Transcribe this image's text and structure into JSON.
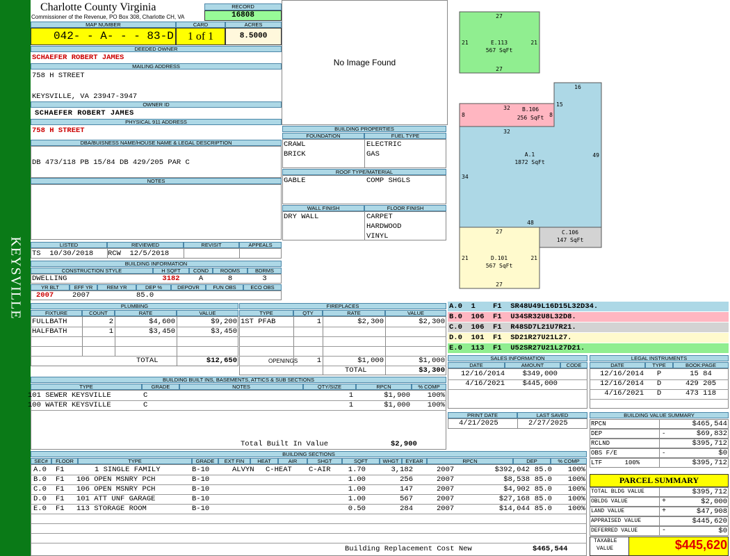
{
  "side_label": "KEYSVILLE",
  "county": {
    "title": "Charlotte County Virginia",
    "sub": "Commissioner of the Revenue, PO Box 308, Charlotte CH, VA"
  },
  "record": {
    "label": "RECORD",
    "value": "16808"
  },
  "map": {
    "label": "MAP NUMBER",
    "value": "042- - A- - - 83-D",
    "card_label": "CARD",
    "card": "1 of 1",
    "acres_label": "ACRES",
    "acres": "8.5000"
  },
  "owner": {
    "deeded_label": "DEEDED OWNER",
    "deeded": "SCHAEFER ROBERT JAMES",
    "mailing_label": "MAILING ADDRESS",
    "mail1": "758 H STREET",
    "mail2": "KEYSVILLE, VA 23947-3947",
    "owner_id_label": "OWNER ID",
    "owner_id": "SCHAEFER ROBERT JAMES",
    "phys_label": "PHYSICAL 911 ADDRESS",
    "phys": "758 H STREET"
  },
  "legal": {
    "label": "DBA/BUISNESS NAME/HOUSE NAME & LEGAL DESCRIPTION",
    "text": "DB 473/118 PB 15/84 DB 429/205 PAR C"
  },
  "notes": {
    "label": "NOTES"
  },
  "image": {
    "no_image": "No Image Found"
  },
  "listed": {
    "listed_label": "LISTED",
    "listed": "TS  10/30/2018",
    "reviewed_label": "REVIEWED",
    "reviewed": "RCW  12/5/2018",
    "revisit_label": "REVISIT",
    "appeals_label": "APPEALS"
  },
  "building_info": {
    "label": "BUILDING INFORMATION",
    "cs_label": "CONSTRUCTION STYLE",
    "hsqft_label": "H SQFT",
    "cond_label": "COND",
    "rooms_label": "ROOMS",
    "bdrms_label": "BDRMS",
    "style": "DWELLING",
    "hsqft": "3182",
    "cond": "A",
    "rooms": "8",
    "bdrms": "3",
    "yrblt_label": "YR BLT",
    "effyr_label": "EFF YR",
    "remyr_label": "REM YR",
    "dep_label": "DEP %",
    "depovr_label": "DEPOVR",
    "funobs_label": "FUN OBS",
    "ecoobs_label": "ECO OBS",
    "yrblt": "2007",
    "effyr": "2007",
    "dep": "85.0"
  },
  "bprops": {
    "label": "BUILDING PROPERTIES",
    "foundation_label": "FOUNDATION",
    "fuel_label": "FUEL TYPE",
    "foundation": [
      "CRAWL",
      "BRICK"
    ],
    "fuel": [
      "ELECTRIC",
      "GAS"
    ],
    "roof_label": "ROOF TYPE/MATERIAL",
    "roof1": "GABLE",
    "roof2": "COMP SHGLS",
    "wall_label": "WALL FINISH",
    "floor_label": "FLOOR FINISH",
    "wall": "DRY WALL",
    "floor": [
      "CARPET",
      "HARDWOOD",
      "VINYL"
    ]
  },
  "plumbing": {
    "label": "PLUMBING",
    "cols": [
      "FIXTURE",
      "COUNT",
      "RATE",
      "VALUE"
    ],
    "rows": [
      [
        "FULLBATH",
        "2",
        "$4,600",
        "$9,200"
      ],
      [
        "HALFBATH",
        "1",
        "$3,450",
        "$3,450"
      ]
    ],
    "total_label": "TOTAL",
    "total": "$12,650"
  },
  "fireplaces": {
    "label": "FIREPLACES",
    "cols": [
      "TYPE",
      "QTY",
      "RATE",
      "VALUE"
    ],
    "rows": [
      [
        "1ST PFAB",
        "1",
        "$2,300",
        "$2,300"
      ]
    ],
    "openings_label": "OPENINGS",
    "openings": [
      "1",
      "$1,000",
      "$1,000"
    ],
    "total_label": "TOTAL",
    "total": "$3,300"
  },
  "builtins": {
    "label": "BUILDING BUILT INS, BASEMENTS, ATTICS & SUB SECTIONS",
    "cols": [
      "TYPE",
      "GRADE",
      "NOTES",
      "QTY/SIZE",
      "RPCN",
      "% COMP"
    ],
    "rows": [
      [
        "101 SEWER KEYSVILLE",
        "C",
        "",
        "1",
        "$1,900",
        "100%"
      ],
      [
        "100 WATER KEYSVILLE",
        "C",
        "",
        "1",
        "$1,000",
        "100%"
      ]
    ],
    "total_label": "Total Built In Value",
    "total": "$2,900"
  },
  "sketch": {
    "areas": [
      {
        "code": "E.113",
        "sqft": "567 SqFt",
        "color": "#90ee90"
      },
      {
        "code": "B.106",
        "sqft": "256 SqFt",
        "color": "#ffb6c1"
      },
      {
        "code": "A.1",
        "sqft": "1872 SqFt",
        "color": "#add8e6"
      },
      {
        "code": "C.106",
        "sqft": "147 SqFt",
        "color": "#d3d3d3"
      },
      {
        "code": "D.101",
        "sqft": "567 SqFt",
        "color": "#fffacd"
      }
    ],
    "dims": {
      "e_top": "27",
      "e_left": "21",
      "e_right": "21",
      "e_bot": "27",
      "b_left": "8",
      "b_top": "32",
      "b_right": "8",
      "b_bot": "32",
      "a_top": "16",
      "a_15": "15",
      "a_right": "49",
      "a_left": "34",
      "a_bot": "48",
      "d_top": "27",
      "d_left": "21",
      "d_right": "21",
      "d_bot": "27"
    }
  },
  "vectors": [
    {
      "text": "A.0  1    F1  SR48U49L16D15L32D34.",
      "color": "#add8e6"
    },
    {
      "text": "B.0  106  F1  U34SR32U8L32D8.",
      "color": "#ffb6c1"
    },
    {
      "text": "C.0  106  F1  R48SD7L21U7R21.",
      "color": "#d3d3d3"
    },
    {
      "text": "D.0  101  F1  SD21R27U21L27.",
      "color": "#fffacd"
    },
    {
      "text": "E.0  113  F1  U52SR27U21L27D21.",
      "color": "#90ee90"
    }
  ],
  "sales": {
    "label": "SALES INFORMATION",
    "cols": [
      "DATE",
      "AMOUNT",
      "CODE"
    ],
    "rows": [
      [
        "12/16/2014",
        "$349,000",
        ""
      ],
      [
        "4/16/2021",
        "$445,000",
        ""
      ]
    ]
  },
  "legal_instr": {
    "label": "LEGAL INSTRUMENTS",
    "cols": [
      "DATE",
      "TYPE",
      "BOOK:PAGE"
    ],
    "rows": [
      [
        "12/16/2014",
        "P",
        "15 84"
      ],
      [
        "12/16/2014",
        "D",
        "429 205"
      ],
      [
        "4/16/2021",
        "D",
        "473 118"
      ]
    ]
  },
  "print": {
    "print_label": "PRINT DATE",
    "print": "4/21/2025",
    "saved_label": "LAST SAVED",
    "saved": "2/27/2025"
  },
  "bvs": {
    "label": "BUILDING VALUE SUMMARY",
    "rows": [
      [
        "RPCN",
        "",
        "$465,544"
      ],
      [
        "DEP",
        "-",
        "$69,832"
      ],
      [
        "RCLND",
        "",
        "$395,712"
      ],
      [
        "OBS F/E",
        "-",
        "$0"
      ],
      [
        "LTF      100%",
        "",
        "$395,712"
      ]
    ]
  },
  "parcel": {
    "label": "PARCEL SUMMARY",
    "rows": [
      [
        "TOTAL BLDG VALUE",
        "",
        "$395,712"
      ],
      [
        "OBLDG VALUE",
        "+",
        "$2,000"
      ],
      [
        "LAND VALUE",
        "+",
        "$47,908"
      ],
      [
        "APPRAISED VALUE",
        "",
        "$445,620"
      ],
      [
        "DEFERRED VALUE",
        "-",
        "$0"
      ]
    ],
    "taxable_label1": "TAXABLE",
    "taxable_label2": "VALUE",
    "taxable": "$445,620"
  },
  "sections": {
    "label": "BUILDING SECTIONS",
    "cols": [
      "SEC#",
      "FLOOR",
      "TYPE",
      "GRADE",
      "EXT FIN",
      "HEAT",
      "AIR",
      "SHGT",
      "SQFT",
      "WHGT",
      "EYEAR",
      "RPCN",
      "DEP",
      "% COMP"
    ],
    "rows": [
      [
        "A.0",
        "F1",
        "1 SINGLE FAMILY",
        "B-10",
        "ALVYN",
        "C-HEAT",
        "C-AIR",
        "1.70",
        "3,182",
        "",
        "2007",
        "$392,042",
        "85.0",
        "100%"
      ],
      [
        "B.0",
        "F1",
        "106 OPEN MSNRY PCH",
        "B-10",
        "",
        "",
        "",
        "1.00",
        "256",
        "",
        "2007",
        "$8,538",
        "85.0",
        "100%"
      ],
      [
        "C.0",
        "F1",
        "106 OPEN MSNRY PCH",
        "B-10",
        "",
        "",
        "",
        "1.00",
        "147",
        "",
        "2007",
        "$4,902",
        "85.0",
        "100%"
      ],
      [
        "D.0",
        "F1",
        "101 ATT UNF GARAGE",
        "B-10",
        "",
        "",
        "",
        "1.00",
        "567",
        "",
        "2007",
        "$27,168",
        "85.0",
        "100%"
      ],
      [
        "E.0",
        "F1",
        "113 STORAGE ROOM",
        "B-10",
        "",
        "",
        "",
        "0.50",
        "284",
        "",
        "2007",
        "$14,044",
        "85.0",
        "100%"
      ]
    ],
    "brcn_label": "Building Replacement Cost New",
    "brcn": "$465,544"
  }
}
